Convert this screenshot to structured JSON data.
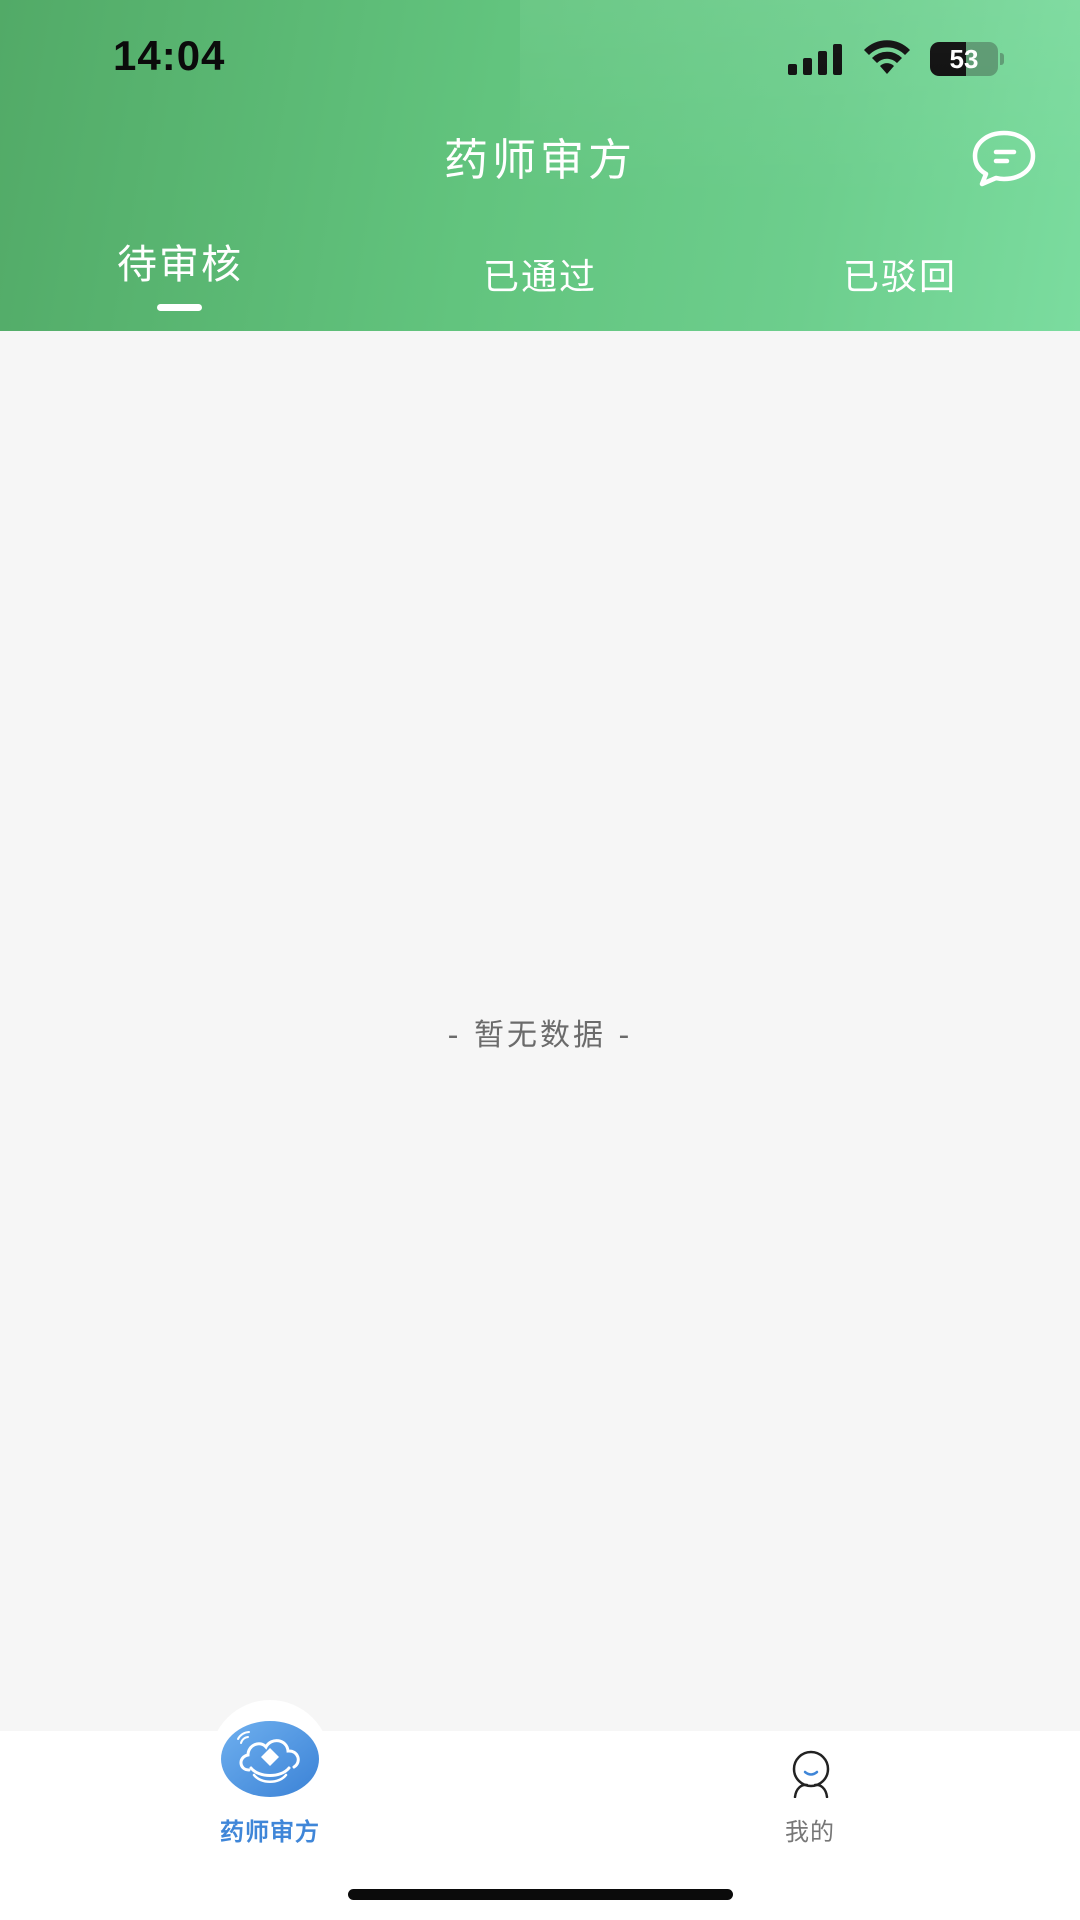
{
  "status_bar": {
    "time": "14:04",
    "battery_level": "53",
    "battery_fraction": 0.53,
    "icons": [
      "signal-icon",
      "wifi-icon",
      "battery-icon"
    ]
  },
  "header": {
    "title": "药师审方",
    "message_icon": "message-icon",
    "gradient_colors": [
      "#52aa67",
      "#7bdc9f"
    ]
  },
  "tabs": [
    {
      "label": "待审核",
      "active": true
    },
    {
      "label": "已通过",
      "active": false
    },
    {
      "label": "已驳回",
      "active": false
    }
  ],
  "main": {
    "empty_text": "- 暂无数据 -"
  },
  "tabbar": {
    "items": [
      {
        "label": "药师审方",
        "icon": "pharmacist-review-icon",
        "active": true,
        "color": "#3f86d8"
      },
      {
        "label": "我的",
        "icon": "profile-icon",
        "active": false,
        "color": "#777777"
      }
    ]
  }
}
